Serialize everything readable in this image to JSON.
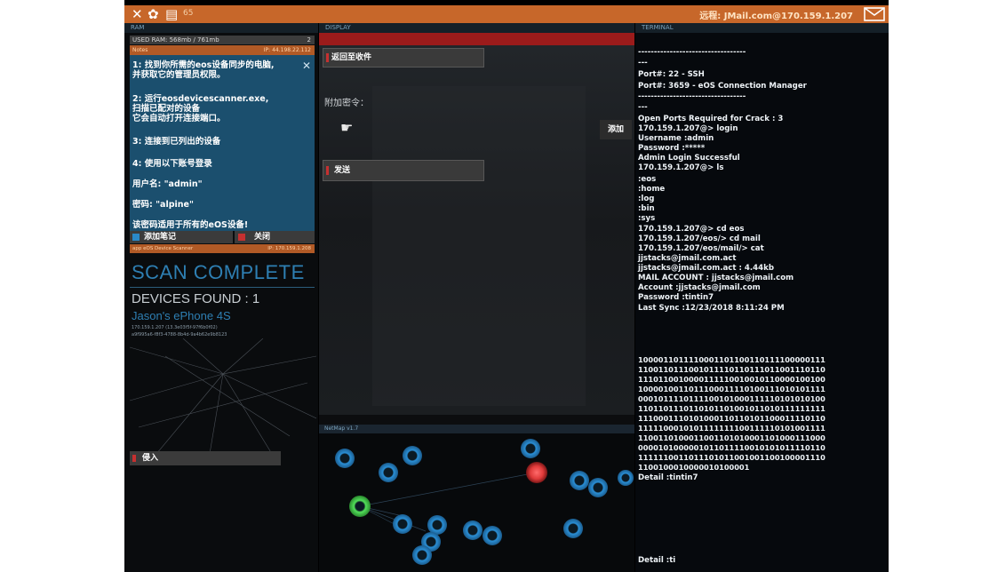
{
  "topbar": {
    "close_icon": "close-icon",
    "settings_icon": "gear-icon",
    "notes_icon": "document-icon",
    "number": "65",
    "mail_text": "远程: JMail.com@170.159.1.207",
    "mail_icon": "envelope-icon",
    "accent_color": "#c7672a"
  },
  "left": {
    "ram_title": "RAM",
    "ram_usage": "USED RAM: 568mb / 761mb",
    "ram_count": "2",
    "notepad_title": "Notes",
    "notepad_ip": "IP: 44.198.22.112",
    "notes": [
      "1: 找到你所需的eos设备同步的电脑,",
      "并获取它的管理员权限。",
      "2: 运行eosdevicescanner.exe,",
      "扫描已配对的设备",
      "它会自动打开连接端口。",
      "3: 连接到已列出的设备",
      "4: 使用以下账号登录",
      "用户名: \"admin\"",
      "密码: \"alpine\"",
      "该密码适用于所有的eOS设备!"
    ],
    "add_note_label": "添加笔记",
    "close_label": "关闭",
    "scanner_title": "app eOS Device Scanner",
    "scanner_ip": "IP: 170.159.1.208",
    "scan_complete": "SCAN COMPLETE",
    "devices_found": "DEVICES FOUND : 1",
    "device_name": "Jason's ePhone 4S",
    "device_detail_1": "170.159.1.207 (13.3e03f5f-97f6b0f02)",
    "device_detail_2": "a9f995a6-f8f3-4788-8b4d-9a4b62e9b8123",
    "hack_label": "侵入"
  },
  "middle": {
    "display_title": "DISPLAY",
    "return_label": "返回至收件",
    "attach_label": "附加密令：",
    "add_label": "添加",
    "send_label": "发送",
    "netmap_title": "NetMap v1.7"
  },
  "terminal": {
    "title": "TERMINAL",
    "lines": [
      "----------------------------------",
      "---",
      "Port#: 22  -  SSH",
      "Port#: 3659  -  eOS Connection Manager",
      "----------------------------------",
      "---",
      "Open Ports Required for Crack : 3",
      "170.159.1.207@> login",
      "Username :admin",
      "Password :*****",
      "Admin Login Successful",
      "170.159.1.207@> ls",
      ":eos",
      ":home",
      ":log",
      ":bin",
      ":sys",
      "170.159.1.207@> cd eos",
      "170.159.1.207/eos/> cd mail",
      "170.159.1.207/eos/mail/> cat",
      "jjstacks@jmail.com.act",
      "jjstacks@jmail.com.act : 4.44kb",
      "MAIL ACCOUNT : jjstacks@jmail.com",
      "Account   :jjstacks@jmail.com",
      "Password :tintin7",
      "Last Sync :12/23/2018 8:11:24 PM"
    ],
    "binary": [
      "1000011011110001101100110111100000111",
      "1100110111001011110110111011001110110",
      "1110110010000111110010010110000100100",
      "1000010011011100011110100111010101111",
      "0001011110111100101000111110101010100",
      "1101101110110101101001011010111111111",
      "1110001110101000110110101100011110110",
      "1111100010101111111100111110101001111",
      "1100110100011001101010001101000111000",
      "0000101000001011011110010101011110110",
      "1111110011011101011001001100100001110",
      "1100100010000010100001"
    ],
    "detail_1": "Detail :tintin7",
    "detail_2": "Detail :ti"
  }
}
